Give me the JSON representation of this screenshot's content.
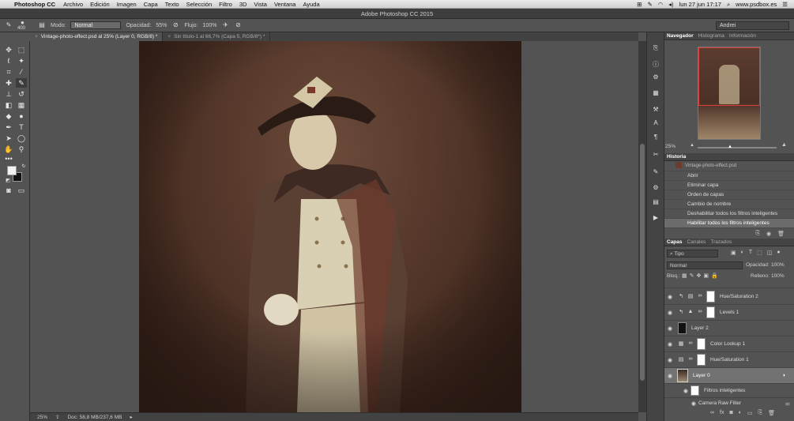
{
  "menubar": {
    "app": "Photoshop CC",
    "items": [
      "Archivo",
      "Edición",
      "Imagen",
      "Capa",
      "Texto",
      "Selección",
      "Filtro",
      "3D",
      "Vista",
      "Ventana",
      "Ayuda"
    ],
    "datetime": "lun 27 jun  17:17",
    "site": "www.psdbox.es"
  },
  "window_title": "Adobe Photoshop CC 2015",
  "options": {
    "brush_size": "400",
    "mode_label": "Modo:",
    "mode_value": "Normal",
    "opacity_label": "Opacidad:",
    "opacity_value": "55%",
    "flow_label": "Flujo:",
    "flow_value": "100%",
    "user": "Andrei"
  },
  "tabs": [
    {
      "label": "Vintage-photo-effect.psd al 25% (Layer 0, RGB/8) *"
    },
    {
      "label": "Sin título-1 al 66,7% (Capa 5, RGB/8*) *"
    }
  ],
  "status": {
    "zoom": "25%",
    "doc": "Doc: 58,8 MB/237,6 MB"
  },
  "navigator": {
    "tabs": [
      "Navegador",
      "Histograma",
      "Información"
    ],
    "zoom": "25%"
  },
  "history": {
    "title": "Historia",
    "top_item": "Vintage-photo-effect.psd",
    "items": [
      "Abrir",
      "Eliminar capa",
      "Orden de capas",
      "Cambio de nombre",
      "Deshabilitar todos los filtros inteligentes",
      "Habilitar todos los filtros inteligentes"
    ]
  },
  "layers_panel": {
    "tabs": [
      "Capas",
      "Canales",
      "Trazados"
    ],
    "filter": "Tipo",
    "blend": "Normal",
    "opacity_label": "Opacidad:",
    "opacity": "100%",
    "lock_label": "Bloq.:",
    "fill_label": "Relleno:",
    "fill": "100%",
    "layers": [
      {
        "name": "Hue/Saturation 2"
      },
      {
        "name": "Levels 1"
      },
      {
        "name": "Layer 2"
      },
      {
        "name": "Color Lookup 1"
      },
      {
        "name": "Hue/Saturation 1"
      },
      {
        "name": "Layer 0"
      }
    ],
    "smart_filters": "Filtros inteligentes",
    "camera_raw": "Camera Raw Filter"
  }
}
